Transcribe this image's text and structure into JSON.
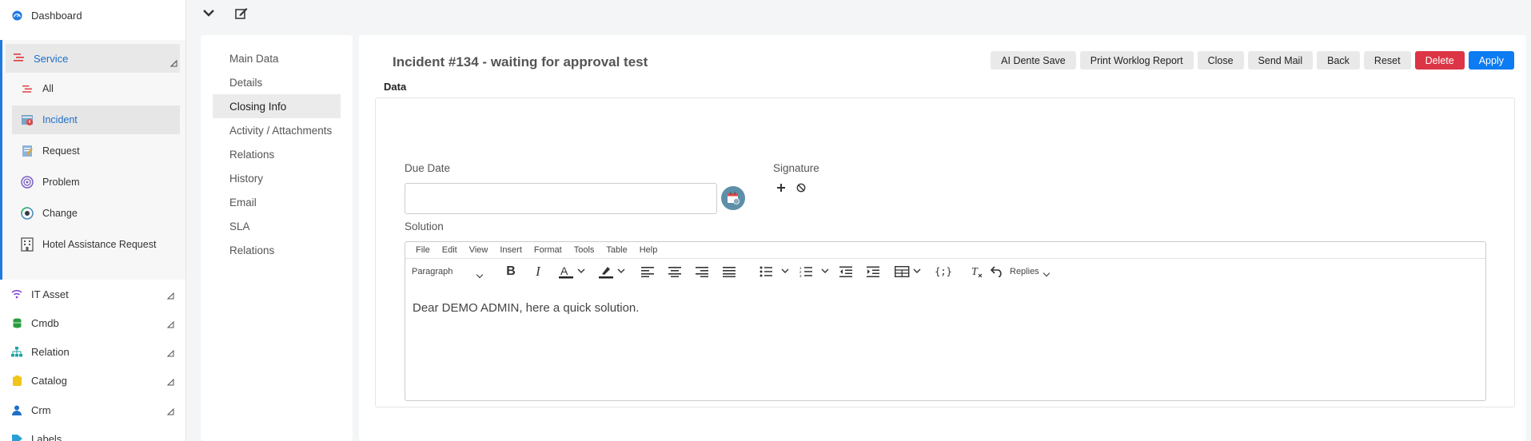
{
  "sidebar": {
    "dashboard": "Dashboard",
    "service": "Service",
    "service_items": [
      "All",
      "Incident",
      "Request",
      "Problem",
      "Change",
      "Hotel Assistance Request"
    ],
    "groups": [
      "IT Asset",
      "Cmdb",
      "Relation",
      "Catalog",
      "Crm",
      "Labels"
    ]
  },
  "tabs": [
    "Main Data",
    "Details",
    "Closing Info",
    "Activity / Attachments",
    "Relations",
    "History",
    "Email",
    "SLA",
    "Relations"
  ],
  "active_tab": "Closing Info",
  "header": {
    "title": "Incident #134 - waiting for approval test",
    "buttons": [
      "AI Dente Save",
      "Print Worklog Report",
      "Close",
      "Send Mail",
      "Back",
      "Reset",
      "Delete",
      "Apply"
    ]
  },
  "section": {
    "label": "Data"
  },
  "form": {
    "due_date_label": "Due Date",
    "due_date_value": "",
    "signature_label": "Signature",
    "solution_label": "Solution"
  },
  "editor": {
    "menu": [
      "File",
      "Edit",
      "View",
      "Insert",
      "Format",
      "Tools",
      "Table",
      "Help"
    ],
    "block_format": "Paragraph",
    "replies_label": "Replies",
    "content": "Dear DEMO ADMIN, here a quick solution."
  },
  "colors": {
    "accent": "#1f7ae0",
    "delete": "#dc3545",
    "apply": "#0d7bf2"
  }
}
